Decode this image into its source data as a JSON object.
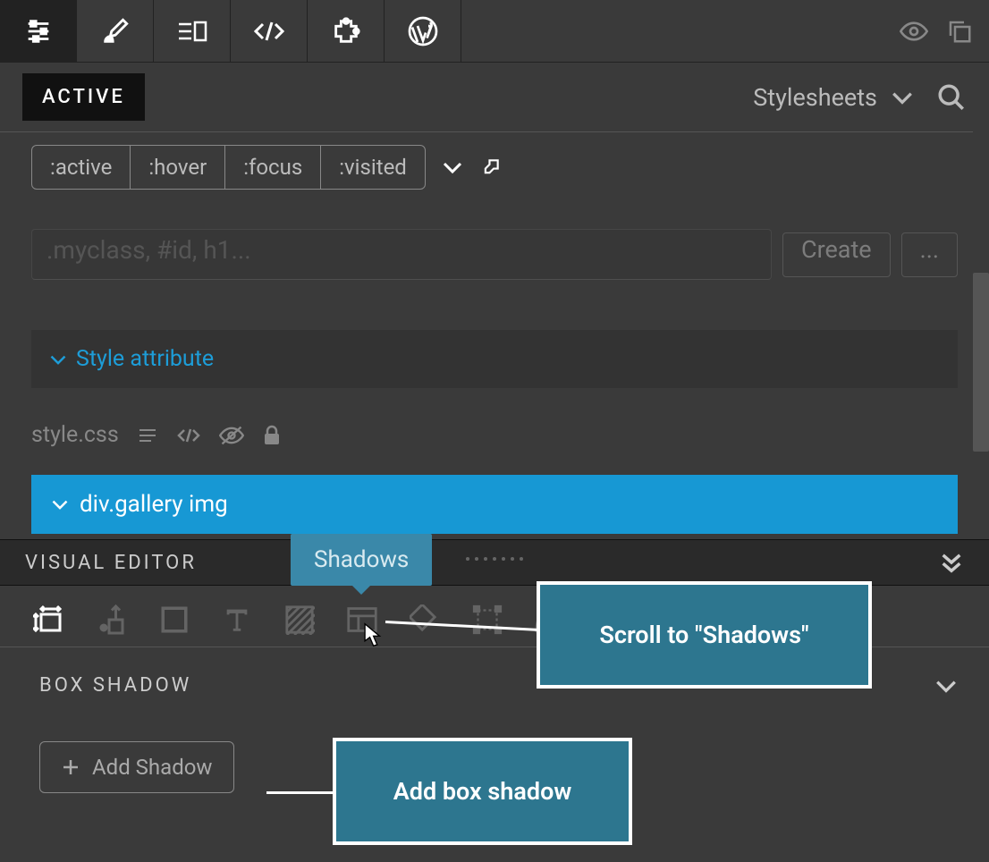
{
  "topbar": {
    "icons": [
      "sliders",
      "brush",
      "actions",
      "code",
      "puzzle",
      "wordpress"
    ],
    "right_icons": [
      "eye",
      "copy"
    ]
  },
  "header": {
    "active_label": "ACTIVE",
    "dropdown_label": "Stylesheets"
  },
  "pseudo_classes": [
    ":active",
    ":hover",
    ":focus",
    ":visited"
  ],
  "selector_input": {
    "placeholder": ".myclass, #id, h1...",
    "create_label": "Create",
    "more_label": "..."
  },
  "style_attribute_label": "Style attribute",
  "stylesheet_name": "style.css",
  "selected_rule": "div.gallery img",
  "visual_editor_title": "VISUAL EDITOR",
  "tooltip_text": "Shadows",
  "box_shadow_title": "BOX SHADOW",
  "add_shadow_label": "Add Shadow",
  "callouts": {
    "scroll": "Scroll to \"Shadows\"",
    "add": "Add box shadow"
  }
}
